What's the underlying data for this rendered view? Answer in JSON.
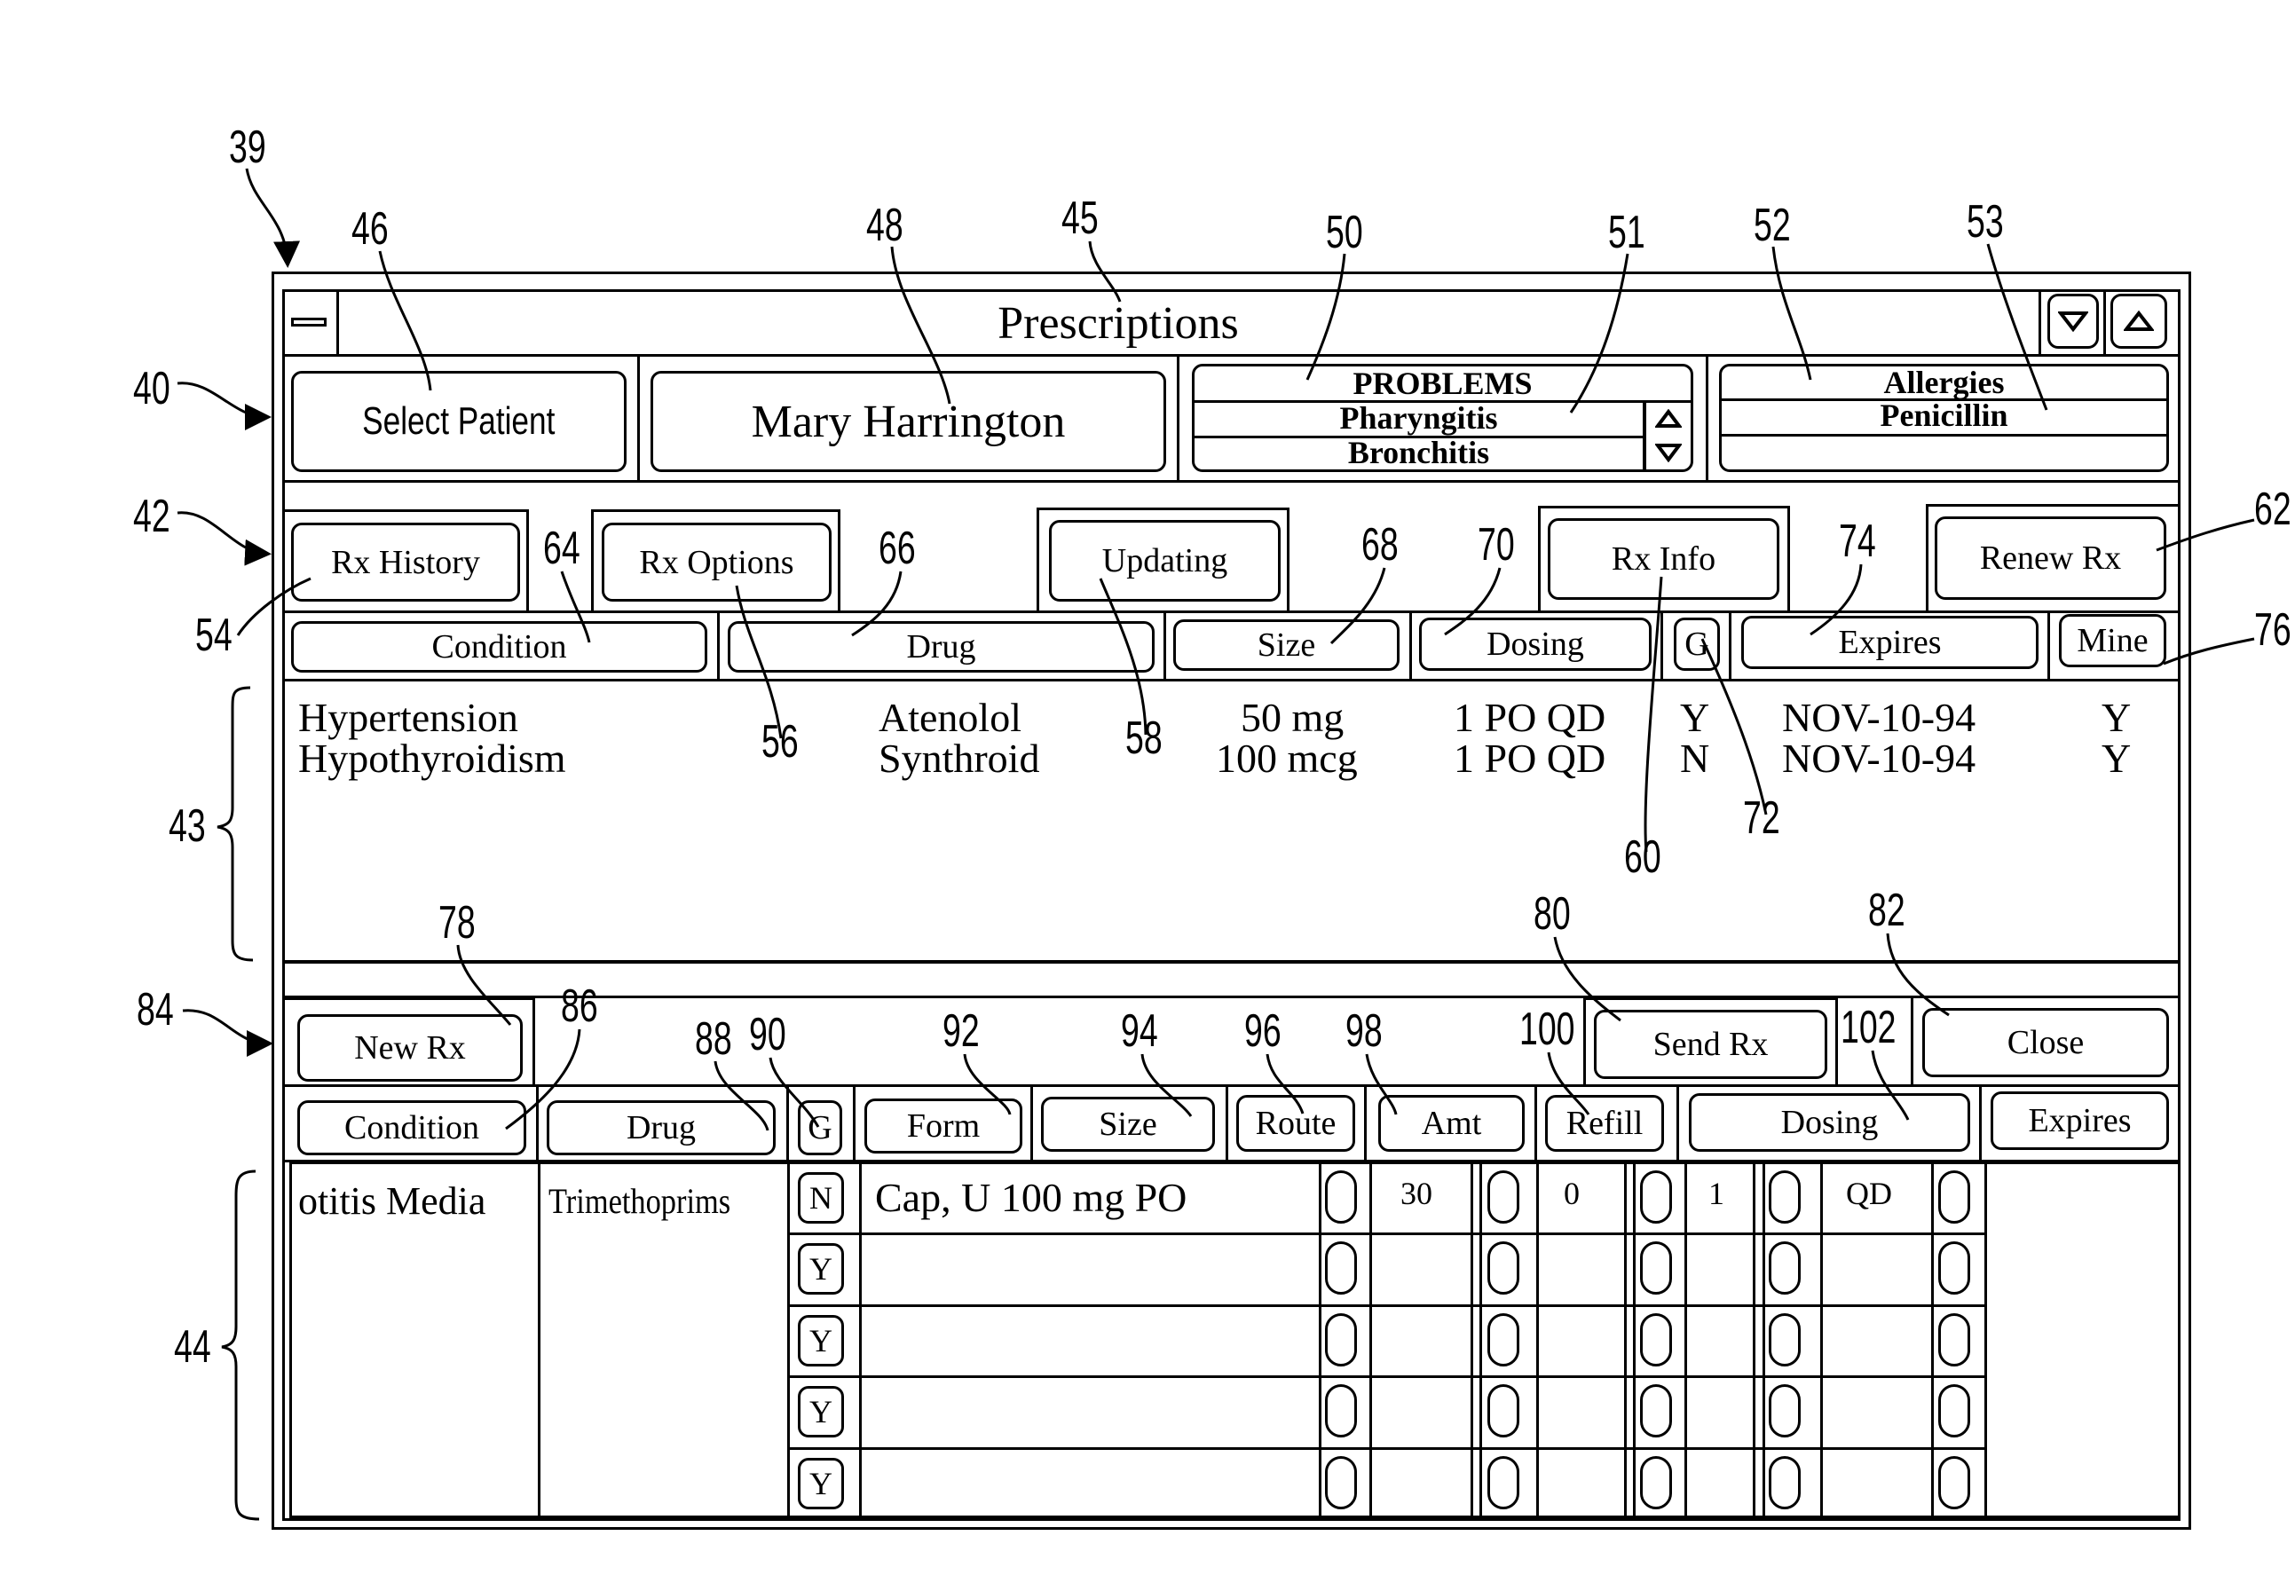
{
  "window": {
    "title": "Prescriptions",
    "system_menu_icon": "minus-bar-icon",
    "minimize_icon": "triangle-down-icon",
    "maximize_icon": "triangle-up-icon"
  },
  "patient_bar": {
    "select_patient_label": "Select Patient",
    "patient_name": "Mary Harrington",
    "problems": {
      "header": "PROBLEMS",
      "items": [
        "Pharyngitis",
        "Bronchitis"
      ],
      "scroll_up_icon": "triangle-up-icon",
      "scroll_down_icon": "triangle-down-icon"
    },
    "allergies": {
      "header": "Allergies",
      "items": [
        "Penicillin",
        ""
      ]
    }
  },
  "history_toolbar": {
    "buttons": [
      "Rx History",
      "Rx Options",
      "Updating",
      "Rx Info",
      "Renew Rx"
    ]
  },
  "history_table": {
    "columns": [
      "Condition",
      "Drug",
      "Size",
      "Dosing",
      "G",
      "Expires",
      "Mine"
    ],
    "rows": [
      {
        "condition": "Hypertension",
        "drug": "Atenolol",
        "size": "50 mg",
        "dosing": "1 PO QD",
        "g": "Y",
        "expires": "NOV-10-94",
        "mine": "Y"
      },
      {
        "condition": "Hypothyroidism",
        "drug": "Synthroid",
        "size": "100 mcg",
        "dosing": "1 PO QD",
        "g": "N",
        "expires": "NOV-10-94",
        "mine": "Y"
      }
    ]
  },
  "new_rx_toolbar": {
    "new_rx_label": "New Rx",
    "send_rx_label": "Send Rx",
    "close_label": "Close"
  },
  "new_rx_table": {
    "columns": [
      "Condition",
      "Drug",
      "G",
      "Form",
      "Size",
      "Route",
      "Amt",
      "Refill",
      "Dosing",
      "Expires"
    ],
    "condition": "otitis Media",
    "drug": "Trimethoprims",
    "rows": [
      {
        "g": "N",
        "form_size_route": "Cap, U 100 mg PO",
        "amt": "30",
        "refill": "0",
        "dose_qty": "1",
        "dosing": "QD"
      },
      {
        "g": "Y",
        "form_size_route": "",
        "amt": "",
        "refill": "",
        "dose_qty": "",
        "dosing": ""
      },
      {
        "g": "Y",
        "form_size_route": "",
        "amt": "",
        "refill": "",
        "dose_qty": "",
        "dosing": ""
      },
      {
        "g": "Y",
        "form_size_route": "",
        "amt": "",
        "refill": "",
        "dose_qty": "",
        "dosing": ""
      },
      {
        "g": "Y",
        "form_size_route": "",
        "amt": "",
        "refill": "",
        "dose_qty": "",
        "dosing": ""
      }
    ]
  },
  "reference_numerals": {
    "r39": "39",
    "r40": "40",
    "r42": "42",
    "r43": "43",
    "r44": "44",
    "r45": "45",
    "r46": "46",
    "r48": "48",
    "r50": "50",
    "r51": "51",
    "r52": "52",
    "r53": "53",
    "r54": "54",
    "r56": "56",
    "r58": "58",
    "r60": "60",
    "r62": "62",
    "r64": "64",
    "r66": "66",
    "r68": "68",
    "r70": "70",
    "r72": "72",
    "r74": "74",
    "r76": "76",
    "r78": "78",
    "r80": "80",
    "r82": "82",
    "r84": "84",
    "r86": "86",
    "r88": "88",
    "r90": "90",
    "r92": "92",
    "r94": "94",
    "r96": "96",
    "r98": "98",
    "r100": "100",
    "r102": "102"
  }
}
